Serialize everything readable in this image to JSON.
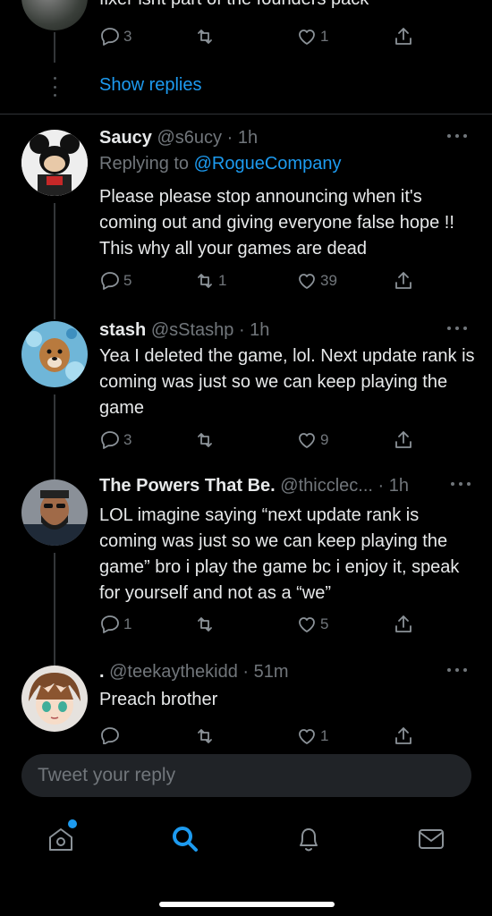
{
  "top_tweet": {
    "cut_text": "fixer isnt part of the founders pack",
    "stats": {
      "replies": "3",
      "retweets": "",
      "likes": "1"
    },
    "show_replies_label": "Show replies"
  },
  "tweets": [
    {
      "display_name": "Saucy",
      "handle": "@s6ucy",
      "time": "1h",
      "replying_prefix": "Replying to",
      "replying_handle": "@RogueCompany",
      "text": "Please please stop announcing when it's coming out and giving everyone false hope !! This why all your games are dead",
      "stats": {
        "replies": "5",
        "retweets": "1",
        "likes": "39"
      }
    },
    {
      "display_name": "stash",
      "handle": "@sStashp",
      "time": "1h",
      "text": "Yea I deleted the game, lol. Next update rank is coming was just so we can keep playing the game",
      "stats": {
        "replies": "3",
        "retweets": "",
        "likes": "9"
      }
    },
    {
      "display_name": "The Powers That Be.",
      "handle": "@thicclec...",
      "time": "1h",
      "text": "LOL imagine saying “next update rank is coming was just so we can keep playing the game” bro i play the game bc i enjoy it, speak for yourself and not as a “we”",
      "stats": {
        "replies": "1",
        "retweets": "",
        "likes": "5"
      }
    },
    {
      "display_name": ".",
      "handle": "@teekaythekidd",
      "time": "51m",
      "text": "Preach brother",
      "stats": {
        "replies": "",
        "retweets": "",
        "likes": "1"
      }
    }
  ],
  "compose": {
    "placeholder": "Tweet your reply"
  },
  "nav": {
    "items": [
      "home-icon",
      "search-icon",
      "bell-icon",
      "mail-icon"
    ],
    "active": "search-icon",
    "accent": "#1d9bf0"
  },
  "colors": {
    "background": "#000000",
    "accent": "#1d9bf0",
    "muted": "#71767b"
  }
}
